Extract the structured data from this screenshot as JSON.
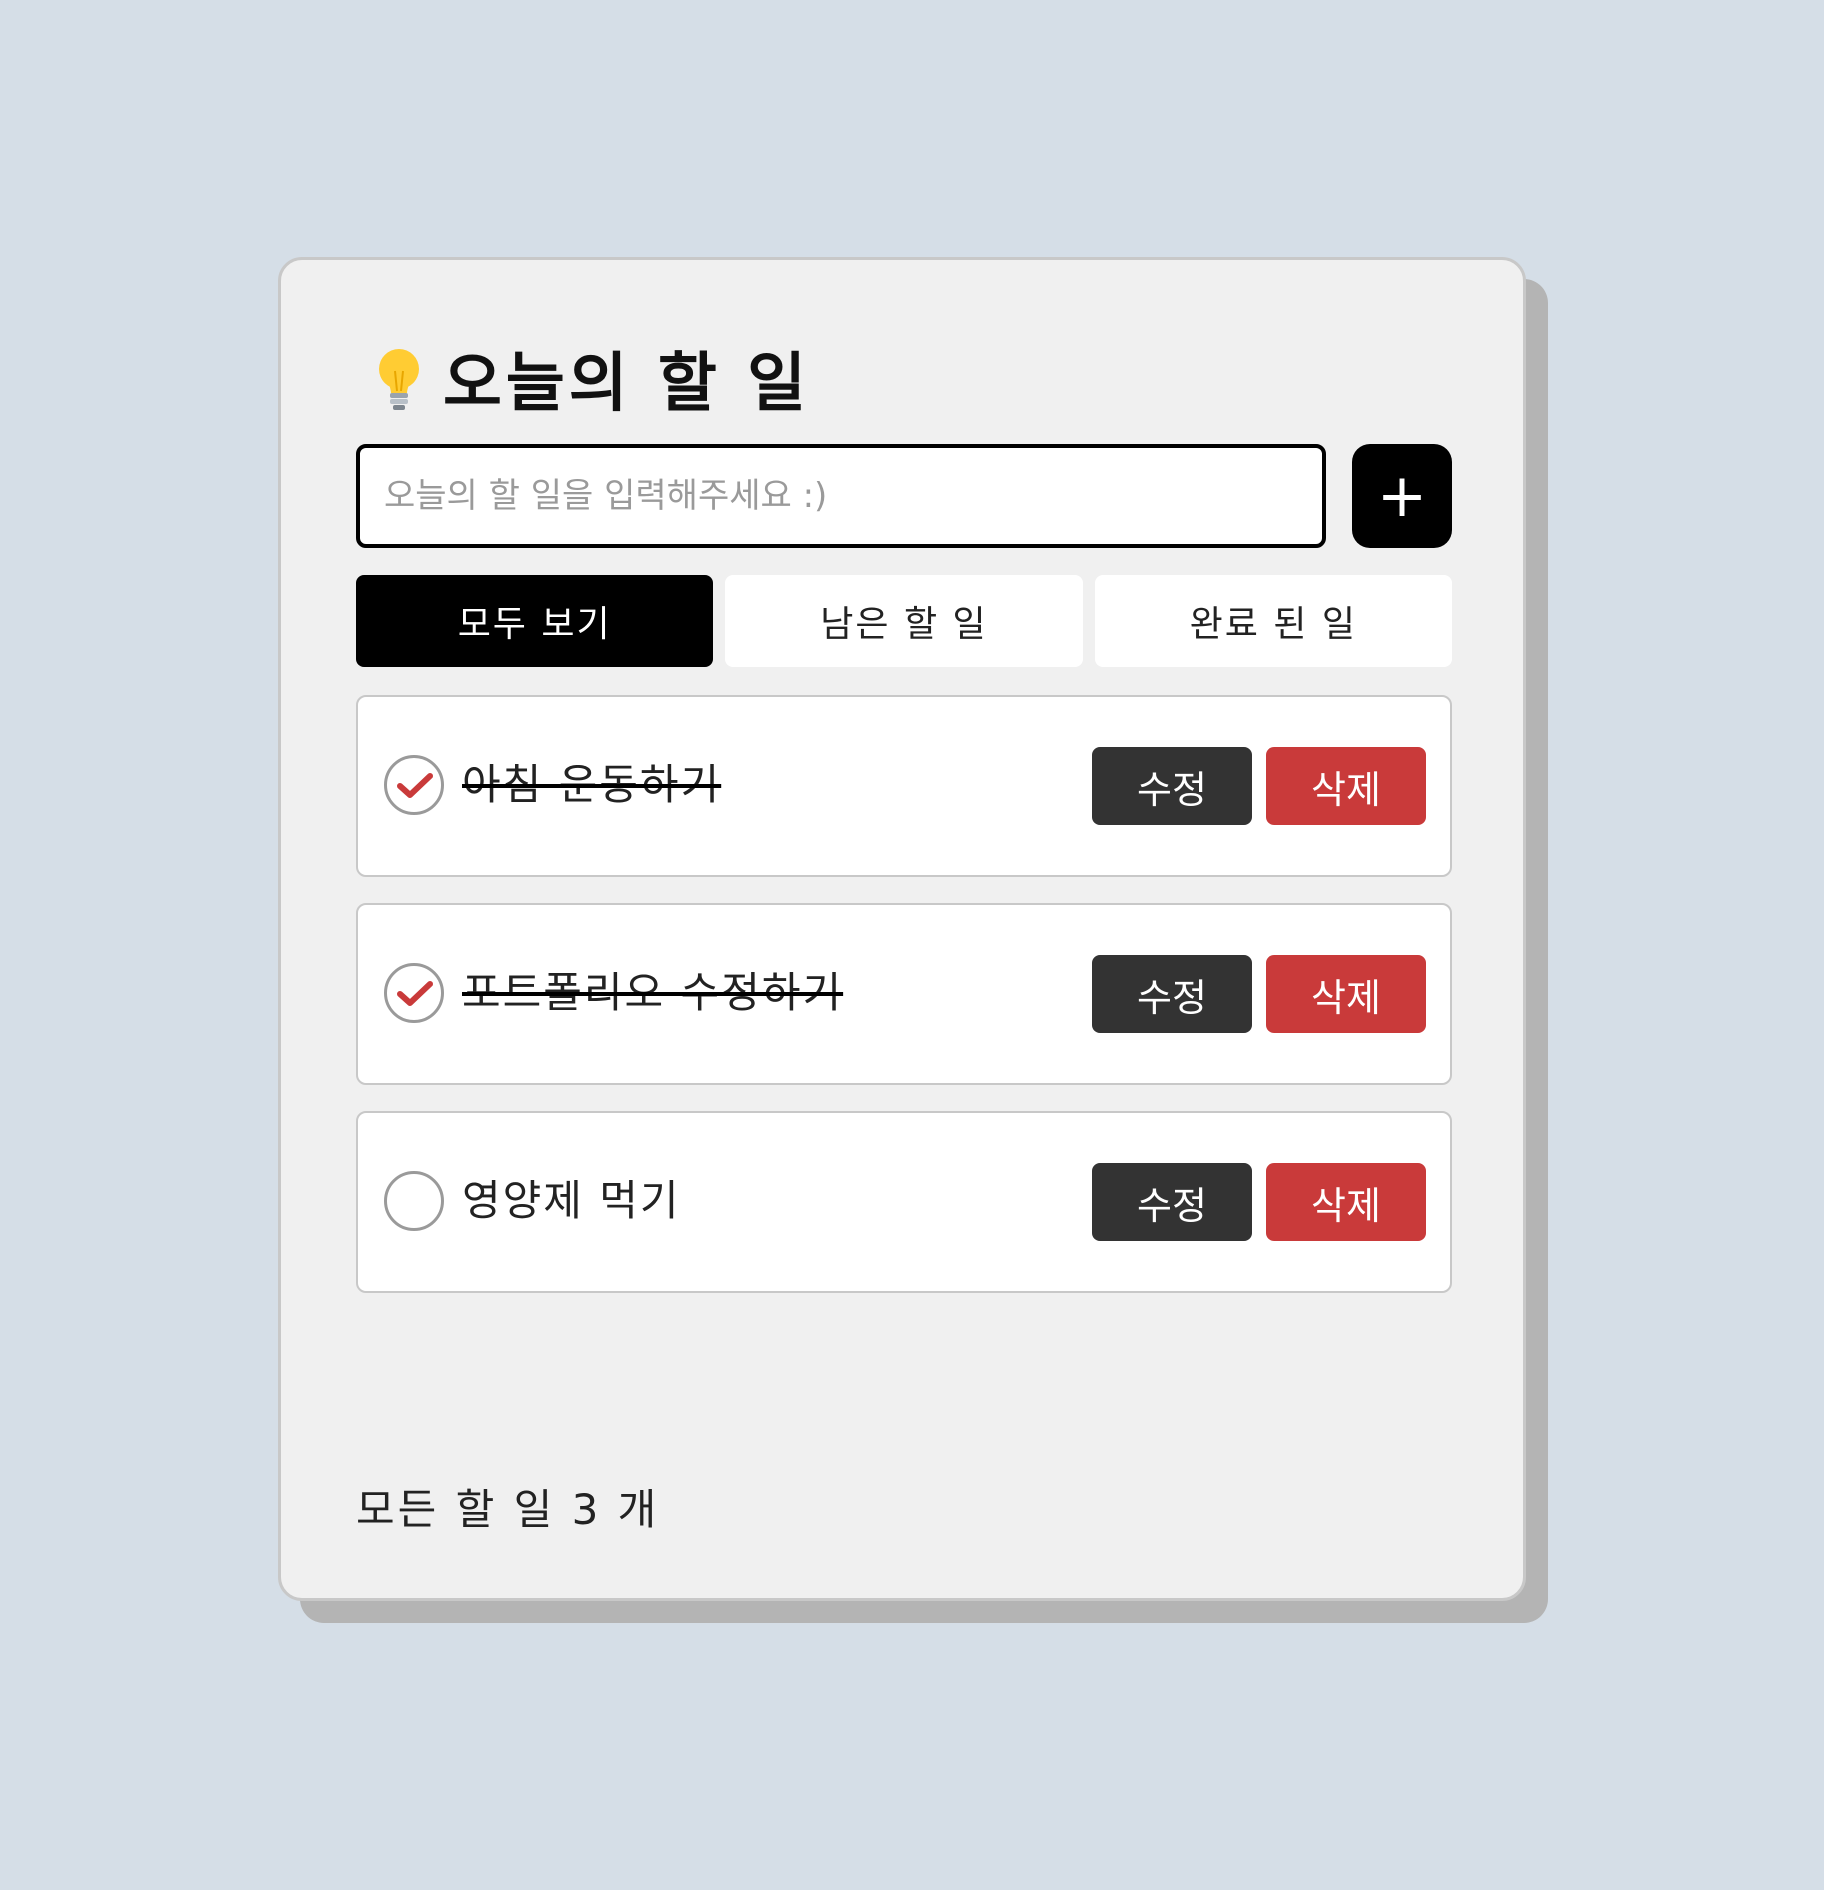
{
  "header": {
    "icon": "lightbulb-icon",
    "title": "오늘의 할 일"
  },
  "input": {
    "value": "",
    "placeholder": "오늘의 할 일을 입력해주세요 :)",
    "add_label": "+"
  },
  "tabs": [
    {
      "label": "모두 보기",
      "active": true
    },
    {
      "label": "남은 할 일",
      "active": false
    },
    {
      "label": "완료 된 일",
      "active": false
    }
  ],
  "todos": [
    {
      "text": "아침 운동하기",
      "done": true,
      "edit_label": "수정",
      "delete_label": "삭제"
    },
    {
      "text": "포트폴리오 수정하기",
      "done": true,
      "edit_label": "수정",
      "delete_label": "삭제"
    },
    {
      "text": "영양제 먹기",
      "done": false,
      "edit_label": "수정",
      "delete_label": "삭제"
    }
  ],
  "footer": {
    "summary": "모든 할 일 3 개"
  },
  "colors": {
    "background": "#d5dee7",
    "card": "#f0f0f0",
    "primary": "#000000",
    "edit_button": "#333333",
    "delete_button": "#c93a3a",
    "check_mark": "#c93a3a"
  }
}
